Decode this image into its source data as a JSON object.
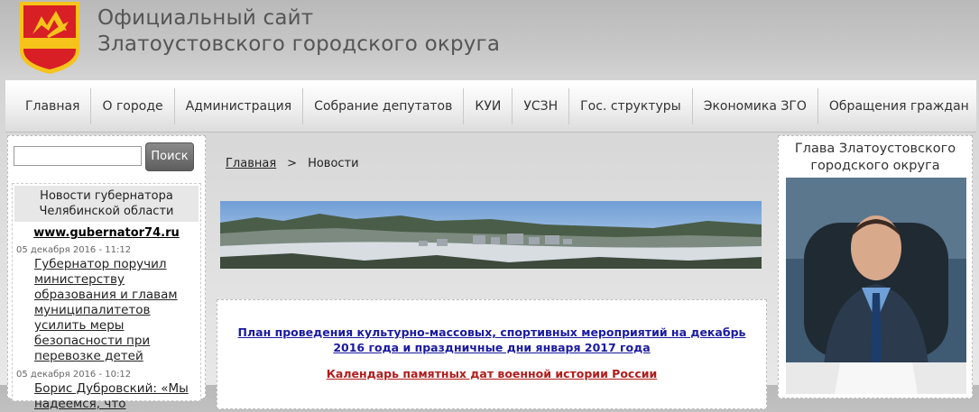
{
  "header": {
    "title_line1": "Официальный сайт",
    "title_line2": "Златоустовского городского округа",
    "logo_icon": "city-coat-of-arms-icon"
  },
  "nav": {
    "items": [
      "Главная",
      "О городе",
      "Администрация",
      "Собрание депутатов",
      "КУИ",
      "УСЗН",
      "Гос. структуры",
      "Экономика ЗГО",
      "Обращения граждан"
    ]
  },
  "search": {
    "placeholder": "",
    "value": "",
    "button_label": "Поиск"
  },
  "governor_news": {
    "header": "Новости губернатора Челябинской области",
    "link": "www.gubernator74.ru",
    "items": [
      {
        "date": "05 декабря 2016 - 11:12",
        "title": "Губернатор поручил министерству образования и главам муниципалитетов усилить меры безопасности при перевозке детей"
      },
      {
        "date": "05 декабря 2016 - 10:12",
        "title": "Борис Дубровский: «Мы надеемся, что"
      }
    ]
  },
  "breadcrumb": {
    "home": "Главная",
    "separator": ">",
    "current": "Новости"
  },
  "main": {
    "plan_link": "План проведения культурно-массовых, спортивных мероприятий на декабрь 2016 года и праздничные дни января 2017 года",
    "calendar_link": "Календарь памятных дат военной истории России"
  },
  "head": {
    "title": "Глава Златоустовского городского округа"
  },
  "colors": {
    "plan_link": "#1a1aa0",
    "calendar_link": "#b01c1c",
    "logo_red": "#d81f26",
    "logo_yellow": "#f6c31b"
  }
}
